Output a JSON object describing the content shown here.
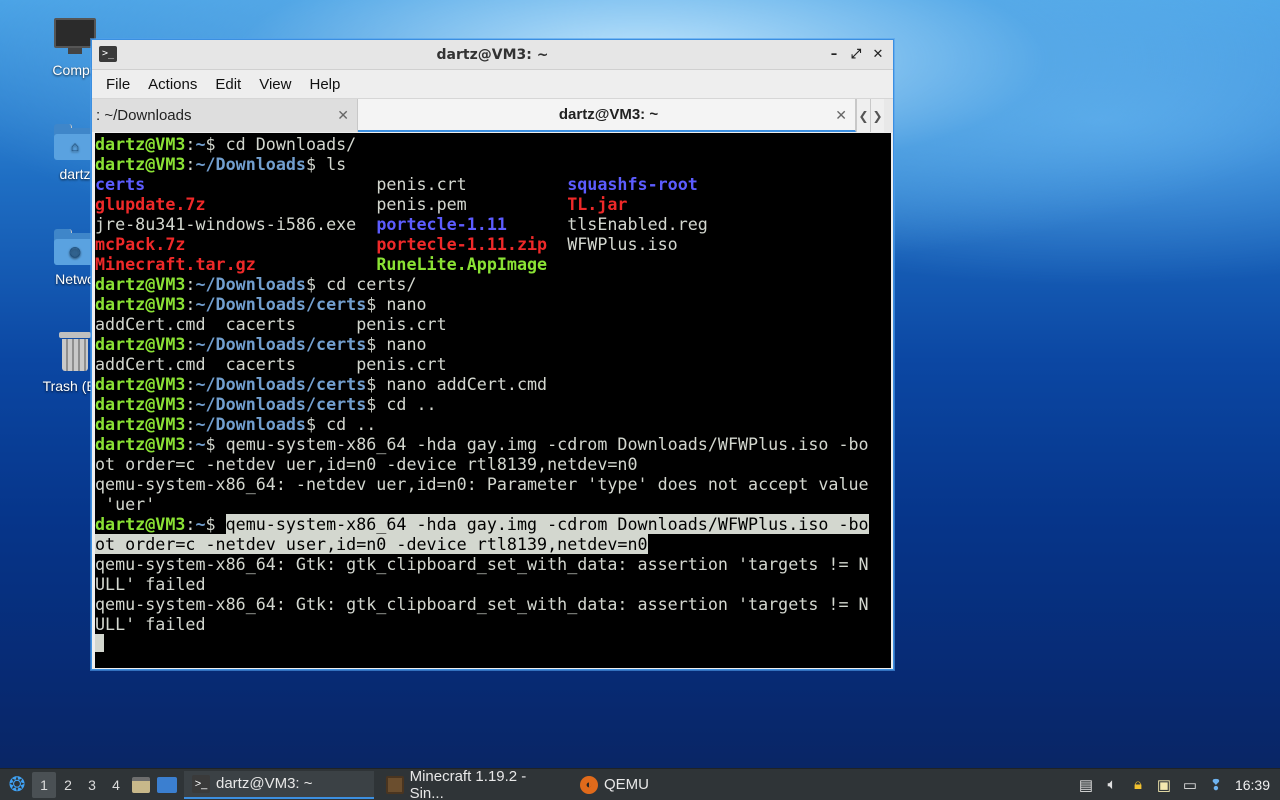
{
  "desktop": {
    "icons": [
      {
        "label": "Compu",
        "icon": "computer-icon"
      },
      {
        "label": "dartz",
        "icon": "home-folder-icon"
      },
      {
        "label": "Netwo",
        "icon": "network-folder-icon"
      },
      {
        "label": "Trash (Em",
        "icon": "trash-icon"
      }
    ]
  },
  "window": {
    "title": "dartz@VM3: ~",
    "menu": [
      "File",
      "Actions",
      "Edit",
      "View",
      "Help"
    ],
    "tabs": [
      {
        "label": ": ~/Downloads",
        "active": false
      },
      {
        "label": "dartz@VM3: ~",
        "active": true
      }
    ],
    "controls": {
      "minimize": "–",
      "maximize": "⤢",
      "close": "✕"
    }
  },
  "terminal": {
    "colors": {
      "user": "#8ae234",
      "path": "#729fcf",
      "dir": "#5c5cff",
      "archive": "#ef2929"
    },
    "lines": [
      {
        "user": "dartz@VM3",
        "path": "~",
        "cmd": "cd Downloads/"
      },
      {
        "user": "dartz@VM3",
        "path": "~/Downloads",
        "cmd": "ls"
      },
      {
        "ls": [
          [
            "certs",
            "dir"
          ],
          [
            "penis.crt",
            ""
          ],
          [
            "squashfs-root",
            "dir"
          ]
        ]
      },
      {
        "ls": [
          [
            "glupdate.7z",
            "arc"
          ],
          [
            "penis.pem",
            ""
          ],
          [
            "TL.jar",
            "arc"
          ]
        ]
      },
      {
        "ls": [
          [
            "jre-8u341-windows-i586.exe",
            ""
          ],
          [
            "portecle-1.11",
            "dir"
          ],
          [
            "tlsEnabled.reg",
            ""
          ]
        ]
      },
      {
        "ls": [
          [
            "mcPack.7z",
            "arc"
          ],
          [
            "portecle-1.11.zip",
            "arc"
          ],
          [
            "WFWPlus.iso",
            ""
          ]
        ]
      },
      {
        "ls": [
          [
            "Minecraft.tar.gz",
            "arc"
          ],
          [
            "RuneLite.AppImage",
            "exe"
          ],
          [
            "",
            ""
          ]
        ]
      },
      {
        "user": "dartz@VM3",
        "path": "~/Downloads",
        "cmd": "cd certs/"
      },
      {
        "user": "dartz@VM3",
        "path": "~/Downloads/certs",
        "cmd": "nano"
      },
      {
        "text": "addCert.cmd  cacerts      penis.crt"
      },
      {
        "user": "dartz@VM3",
        "path": "~/Downloads/certs",
        "cmd": "nano"
      },
      {
        "text": "addCert.cmd  cacerts      penis.crt"
      },
      {
        "user": "dartz@VM3",
        "path": "~/Downloads/certs",
        "cmd": "nano addCert.cmd"
      },
      {
        "user": "dartz@VM3",
        "path": "~/Downloads/certs",
        "cmd": "cd .."
      },
      {
        "user": "dartz@VM3",
        "path": "~/Downloads",
        "cmd": "cd .."
      },
      {
        "user": "dartz@VM3",
        "path": "~",
        "cmd": "qemu-system-x86_64 -hda gay.img -cdrom Downloads/WFWPlus.iso -bo"
      },
      {
        "text": "ot order=c -netdev uer,id=n0 -device rtl8139,netdev=n0"
      },
      {
        "text": "qemu-system-x86_64: -netdev uer,id=n0: Parameter 'type' does not accept value"
      },
      {
        "text": " 'uer'"
      },
      {
        "user": "dartz@VM3",
        "path": "~",
        "cmd": "qemu-system-x86_64 -hda gay.img -cdrom Downloads/WFWPlus.iso -bo",
        "selected": true
      },
      {
        "text": "ot order=c -netdev user,id=n0 -device rtl8139,netdev=n0",
        "selected": true
      },
      {
        "text": "qemu-system-x86_64: Gtk: gtk_clipboard_set_with_data: assertion 'targets != N"
      },
      {
        "text": "ULL' failed"
      },
      {
        "text": "qemu-system-x86_64: Gtk: gtk_clipboard_set_with_data: assertion 'targets != N"
      },
      {
        "text": "ULL' failed"
      },
      {
        "cursor": true
      }
    ]
  },
  "taskbar": {
    "workspaces": [
      "1",
      "2",
      "3",
      "4"
    ],
    "active_workspace": "1",
    "tasks": [
      {
        "label": "dartz@VM3: ~",
        "icon": "terminal-icon",
        "active": true
      },
      {
        "label": "Minecraft 1.19.2 - Sin...",
        "icon": "minecraft-icon",
        "active": false
      },
      {
        "label": "QEMU",
        "icon": "qemu-icon",
        "active": false
      }
    ],
    "tray": [
      "update-icon",
      "volume-icon",
      "lock-icon",
      "clipboard-icon",
      "network-icon",
      "notification-icon"
    ],
    "clock": "16:39"
  }
}
